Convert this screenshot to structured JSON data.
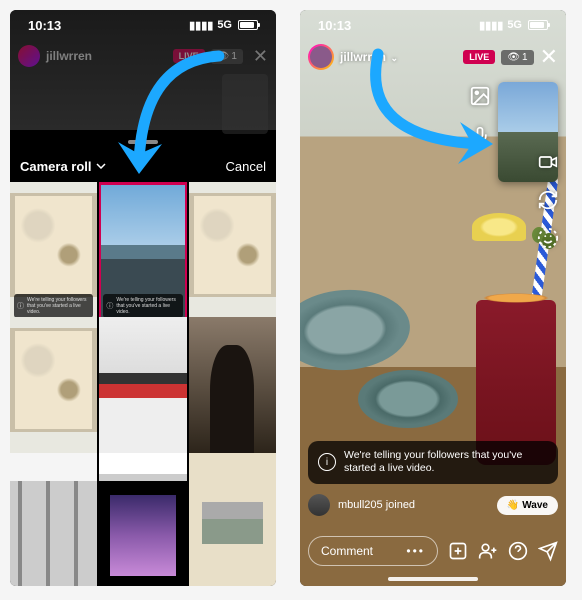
{
  "status": {
    "time": "10:13",
    "network": "5G"
  },
  "colors": {
    "arrow": "#1ca8ff",
    "live": "#ed0050"
  },
  "left": {
    "username": "jillwrren",
    "live_label": "LIVE",
    "viewers": "1",
    "sheet_title": "Camera roll",
    "sheet_cancel": "Cancel",
    "thumb_caption": "We're telling your followers that you've started a live video."
  },
  "right": {
    "username": "jillwrren",
    "live_label": "LIVE",
    "viewers": "1",
    "notif_text": "We're telling your followers that you've started a live video.",
    "joined_user": "mbull205 joined",
    "wave_label": "Wave",
    "wave_emoji": "👋",
    "comment_placeholder": "Comment",
    "side_tools": [
      "image-icon",
      "mic-icon",
      "video-icon",
      "flip-camera-icon",
      "effects-icon"
    ]
  }
}
